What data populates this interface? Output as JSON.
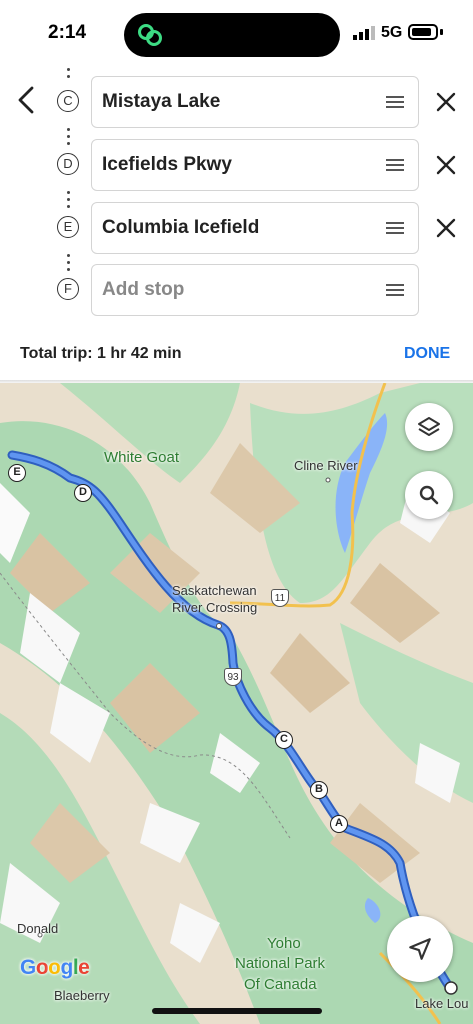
{
  "status_bar": {
    "time": "2:14",
    "network": "5G"
  },
  "stops": [
    {
      "letter": "C",
      "value": "Mistaya Lake"
    },
    {
      "letter": "D",
      "value": "Icefields Pkwy"
    },
    {
      "letter": "E",
      "value": "Columbia Icefield"
    },
    {
      "letter": "F",
      "value": "",
      "placeholder": "Add stop"
    }
  ],
  "trip": {
    "summary": "Total trip: 1 hr 42 min",
    "done_label": "DONE"
  },
  "map": {
    "labels": {
      "white_goat": "White Goat",
      "cline_river": "Cline River",
      "crossing_1": "Saskatchewan",
      "crossing_2": "River Crossing",
      "donald": "Donald",
      "yoho_1": "Yoho",
      "yoho_2": "National Park",
      "yoho_3": "Of Canada",
      "blaeberry": "Blaeberry",
      "lake_louise": "Lake Lou"
    },
    "route_markers": [
      "E",
      "D",
      "C",
      "B",
      "A"
    ],
    "highway_shields": [
      "11",
      "93"
    ],
    "attribution": "Google",
    "colors": {
      "route": "#3b78e7",
      "forest": "#a8d9b0",
      "terrain": "#e6dccb",
      "water": "#8ab4f8"
    }
  }
}
